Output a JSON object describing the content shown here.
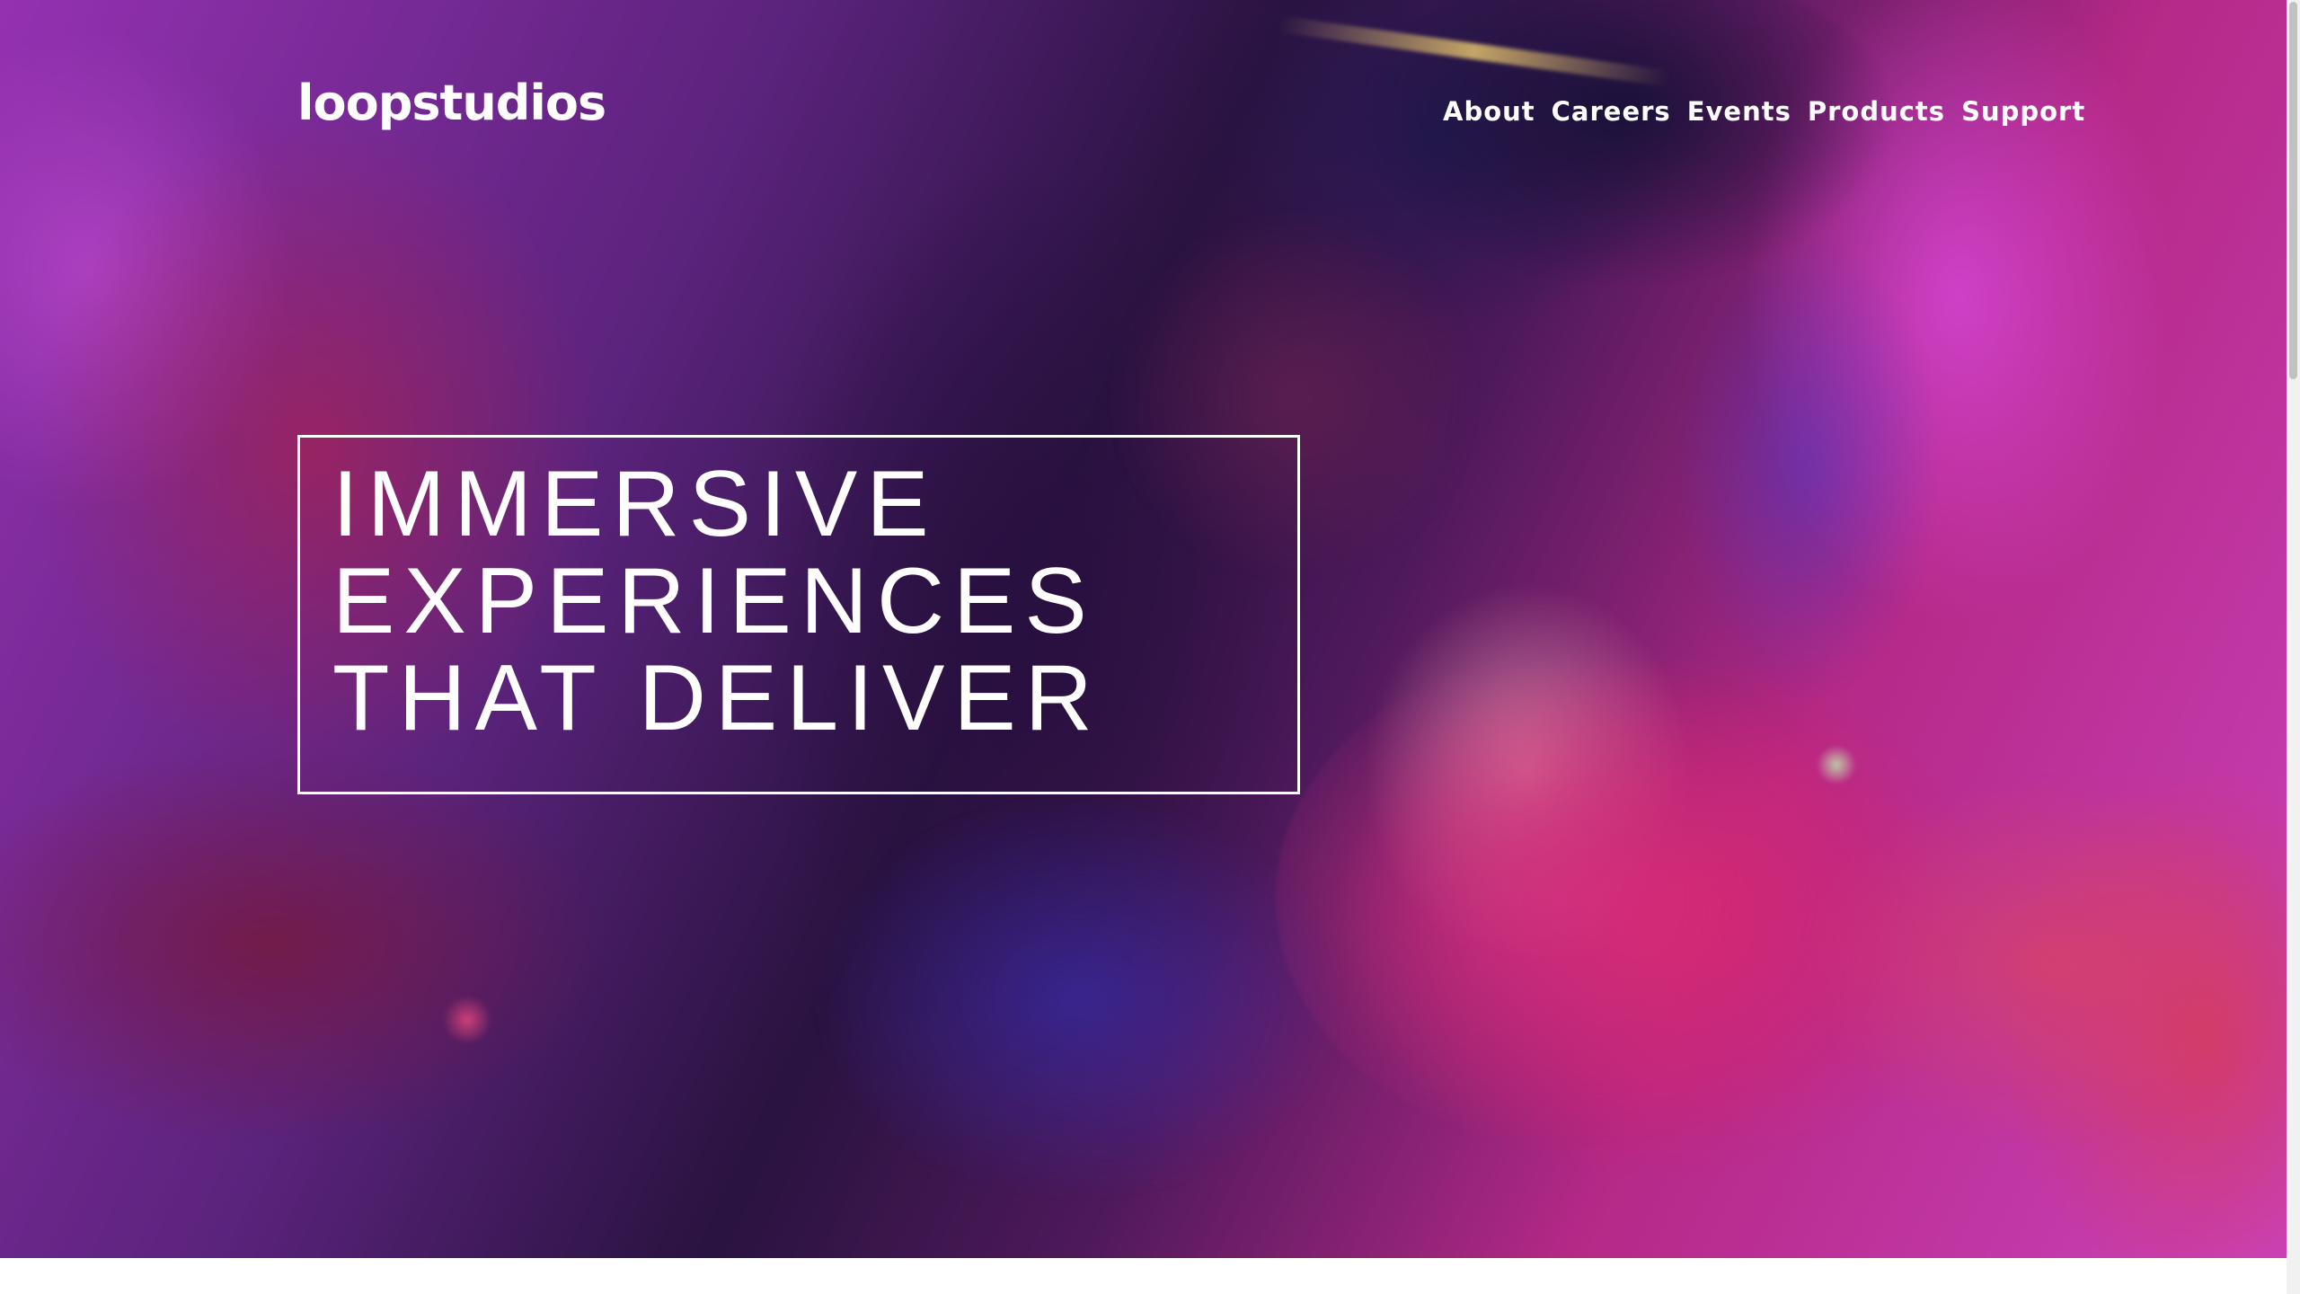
{
  "header": {
    "logo_text": "loopstudios",
    "nav": [
      {
        "label": "About"
      },
      {
        "label": "Careers"
      },
      {
        "label": "Events"
      },
      {
        "label": "Products"
      },
      {
        "label": "Support"
      }
    ]
  },
  "hero": {
    "headline_lines": [
      "IMMERSIVE",
      "EXPERIENCES",
      "THAT DELIVER"
    ],
    "background_image": "vr-headset-person-neon-pink-purple"
  },
  "colors": {
    "text": "#ffffff",
    "accent_pink": "#f14fdb",
    "accent_magenta": "#d8319c",
    "deep_purple": "#2e1646"
  }
}
